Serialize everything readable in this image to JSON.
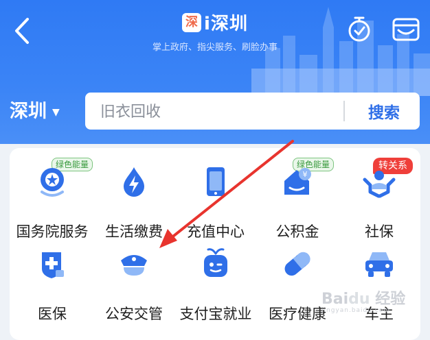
{
  "header": {
    "logo_char": "深",
    "title": "i深圳",
    "subtitle": "掌上政府、指尖服务、刷脸办事",
    "icons": [
      "back-arrow-icon",
      "timer-icon",
      "card-wallet-icon"
    ]
  },
  "location": {
    "city": "深圳"
  },
  "search": {
    "placeholder": "旧衣回收",
    "button_label": "搜索"
  },
  "services": [
    {
      "label": "国务院服务",
      "icon": "state-council-emblem-icon",
      "badge": "绿色能量",
      "badge_type": "green"
    },
    {
      "label": "生活缴费",
      "icon": "bolt-drop-icon",
      "badge": "",
      "badge_type": ""
    },
    {
      "label": "充值中心",
      "icon": "phone-recharge-icon",
      "badge": "",
      "badge_type": ""
    },
    {
      "label": "公积金",
      "icon": "housing-fund-icon",
      "badge": "绿色能量",
      "badge_type": "green"
    },
    {
      "label": "社保",
      "icon": "social-security-icon",
      "badge": "转关系",
      "badge_type": "red"
    },
    {
      "label": "医保",
      "icon": "medical-insurance-icon",
      "badge": "",
      "badge_type": ""
    },
    {
      "label": "公安交管",
      "icon": "police-cap-icon",
      "badge": "",
      "badge_type": ""
    },
    {
      "label": "支付宝就业",
      "icon": "alipay-robot-icon",
      "badge": "",
      "badge_type": ""
    },
    {
      "label": "医疗健康",
      "icon": "pill-capsule-icon",
      "badge": "",
      "badge_type": ""
    },
    {
      "label": "车主",
      "icon": "car-icon",
      "badge": "",
      "badge_type": ""
    }
  ],
  "colors": {
    "header_blue": "#3b84f6",
    "icon_blue": "#2f6fe8",
    "annotation_red": "#e8342e"
  }
}
